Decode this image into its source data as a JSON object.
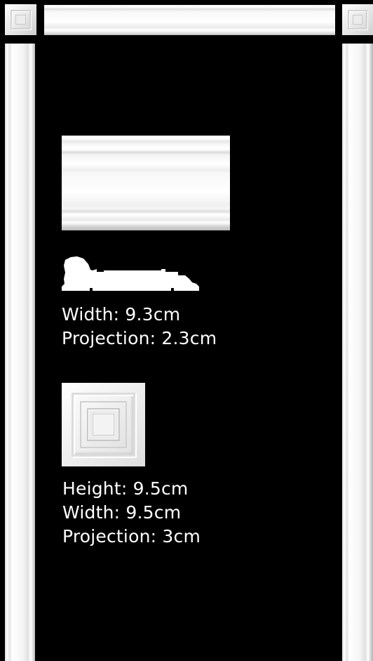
{
  "colors": {
    "background": "#000000",
    "plaster_white": "#ffffff",
    "text": "#ffffff"
  },
  "frame": {
    "corner_rosette_icon": "square-rosette-icon",
    "header_casing": "head-casing",
    "side_casing": "side-casing"
  },
  "moulding": {
    "sample_image": "moulding-front-view",
    "profile_icon": "moulding-profile-silhouette",
    "specs": {
      "width": "Width: 9.3cm",
      "projection": "Projection: 2.3cm"
    }
  },
  "rosette": {
    "sample_image": "square-rosette-front-view",
    "specs": {
      "height": "Height: 9.5cm",
      "width": "Width: 9.5cm",
      "projection": "Projection: 3cm"
    }
  }
}
